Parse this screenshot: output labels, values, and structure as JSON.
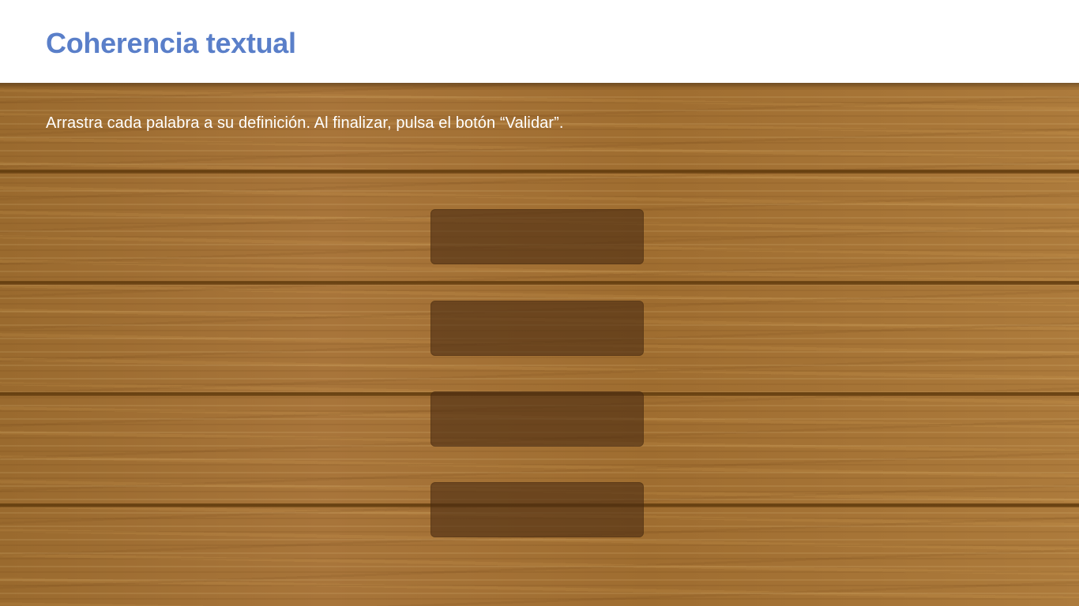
{
  "header": {
    "title": "Coherencia textual"
  },
  "activity": {
    "instructions": "Arrastra cada palabra a su definición. Al finalizar, pulsa el botón “Validar”.",
    "drop_zones": [
      {
        "label": ""
      },
      {
        "label": ""
      },
      {
        "label": ""
      },
      {
        "label": ""
      }
    ]
  },
  "colors": {
    "title": "#5a7fc9",
    "header_bg": "#ffffff",
    "wood": "#a8753a",
    "drop_zone": "#4a2c12"
  }
}
